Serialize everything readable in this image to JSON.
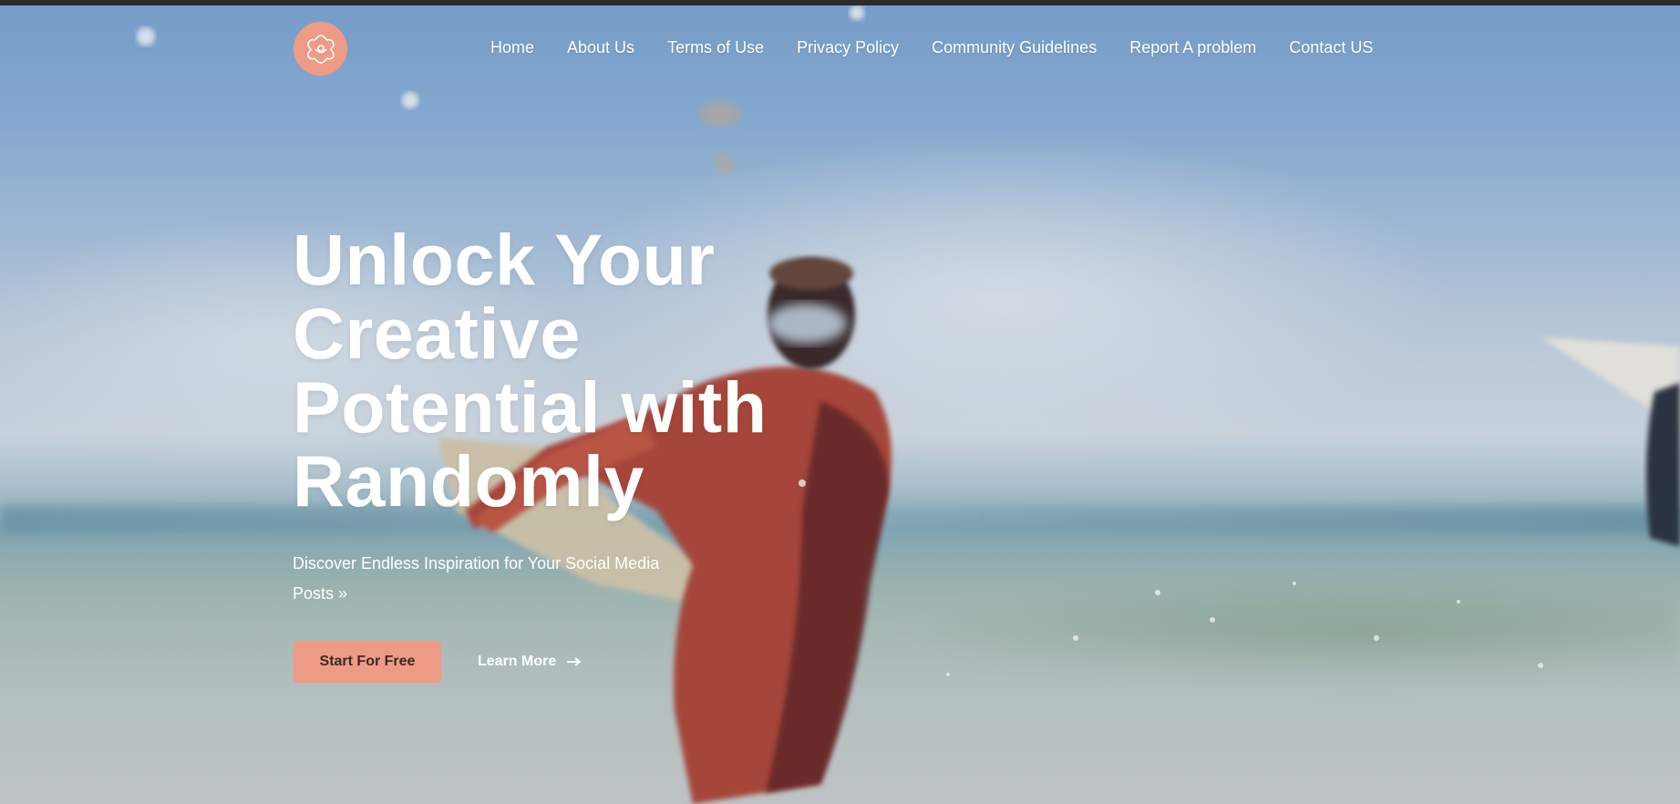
{
  "colors": {
    "accent": "#ee9b86",
    "topbar": "#2b2b2b",
    "text_light": "#ffffff",
    "button_text": "#3a2a25"
  },
  "header": {
    "logo_icon": "flower-icon",
    "nav": [
      {
        "label": "Home"
      },
      {
        "label": "About Us"
      },
      {
        "label": "Terms of Use"
      },
      {
        "label": "Privacy Policy"
      },
      {
        "label": "Community Guidelines"
      },
      {
        "label": "Report A problem"
      },
      {
        "label": "Contact US"
      }
    ]
  },
  "hero": {
    "headline_lines": [
      "Unlock Your",
      "Creative",
      "Potential with",
      "Randomly"
    ],
    "subtitle": "Discover Endless Inspiration for Your Social Media Posts »",
    "primary_cta": "Start For Free",
    "secondary_cta": "Learn More",
    "secondary_icon": "arrow-right-icon",
    "background": "surfer-beach-photo"
  }
}
